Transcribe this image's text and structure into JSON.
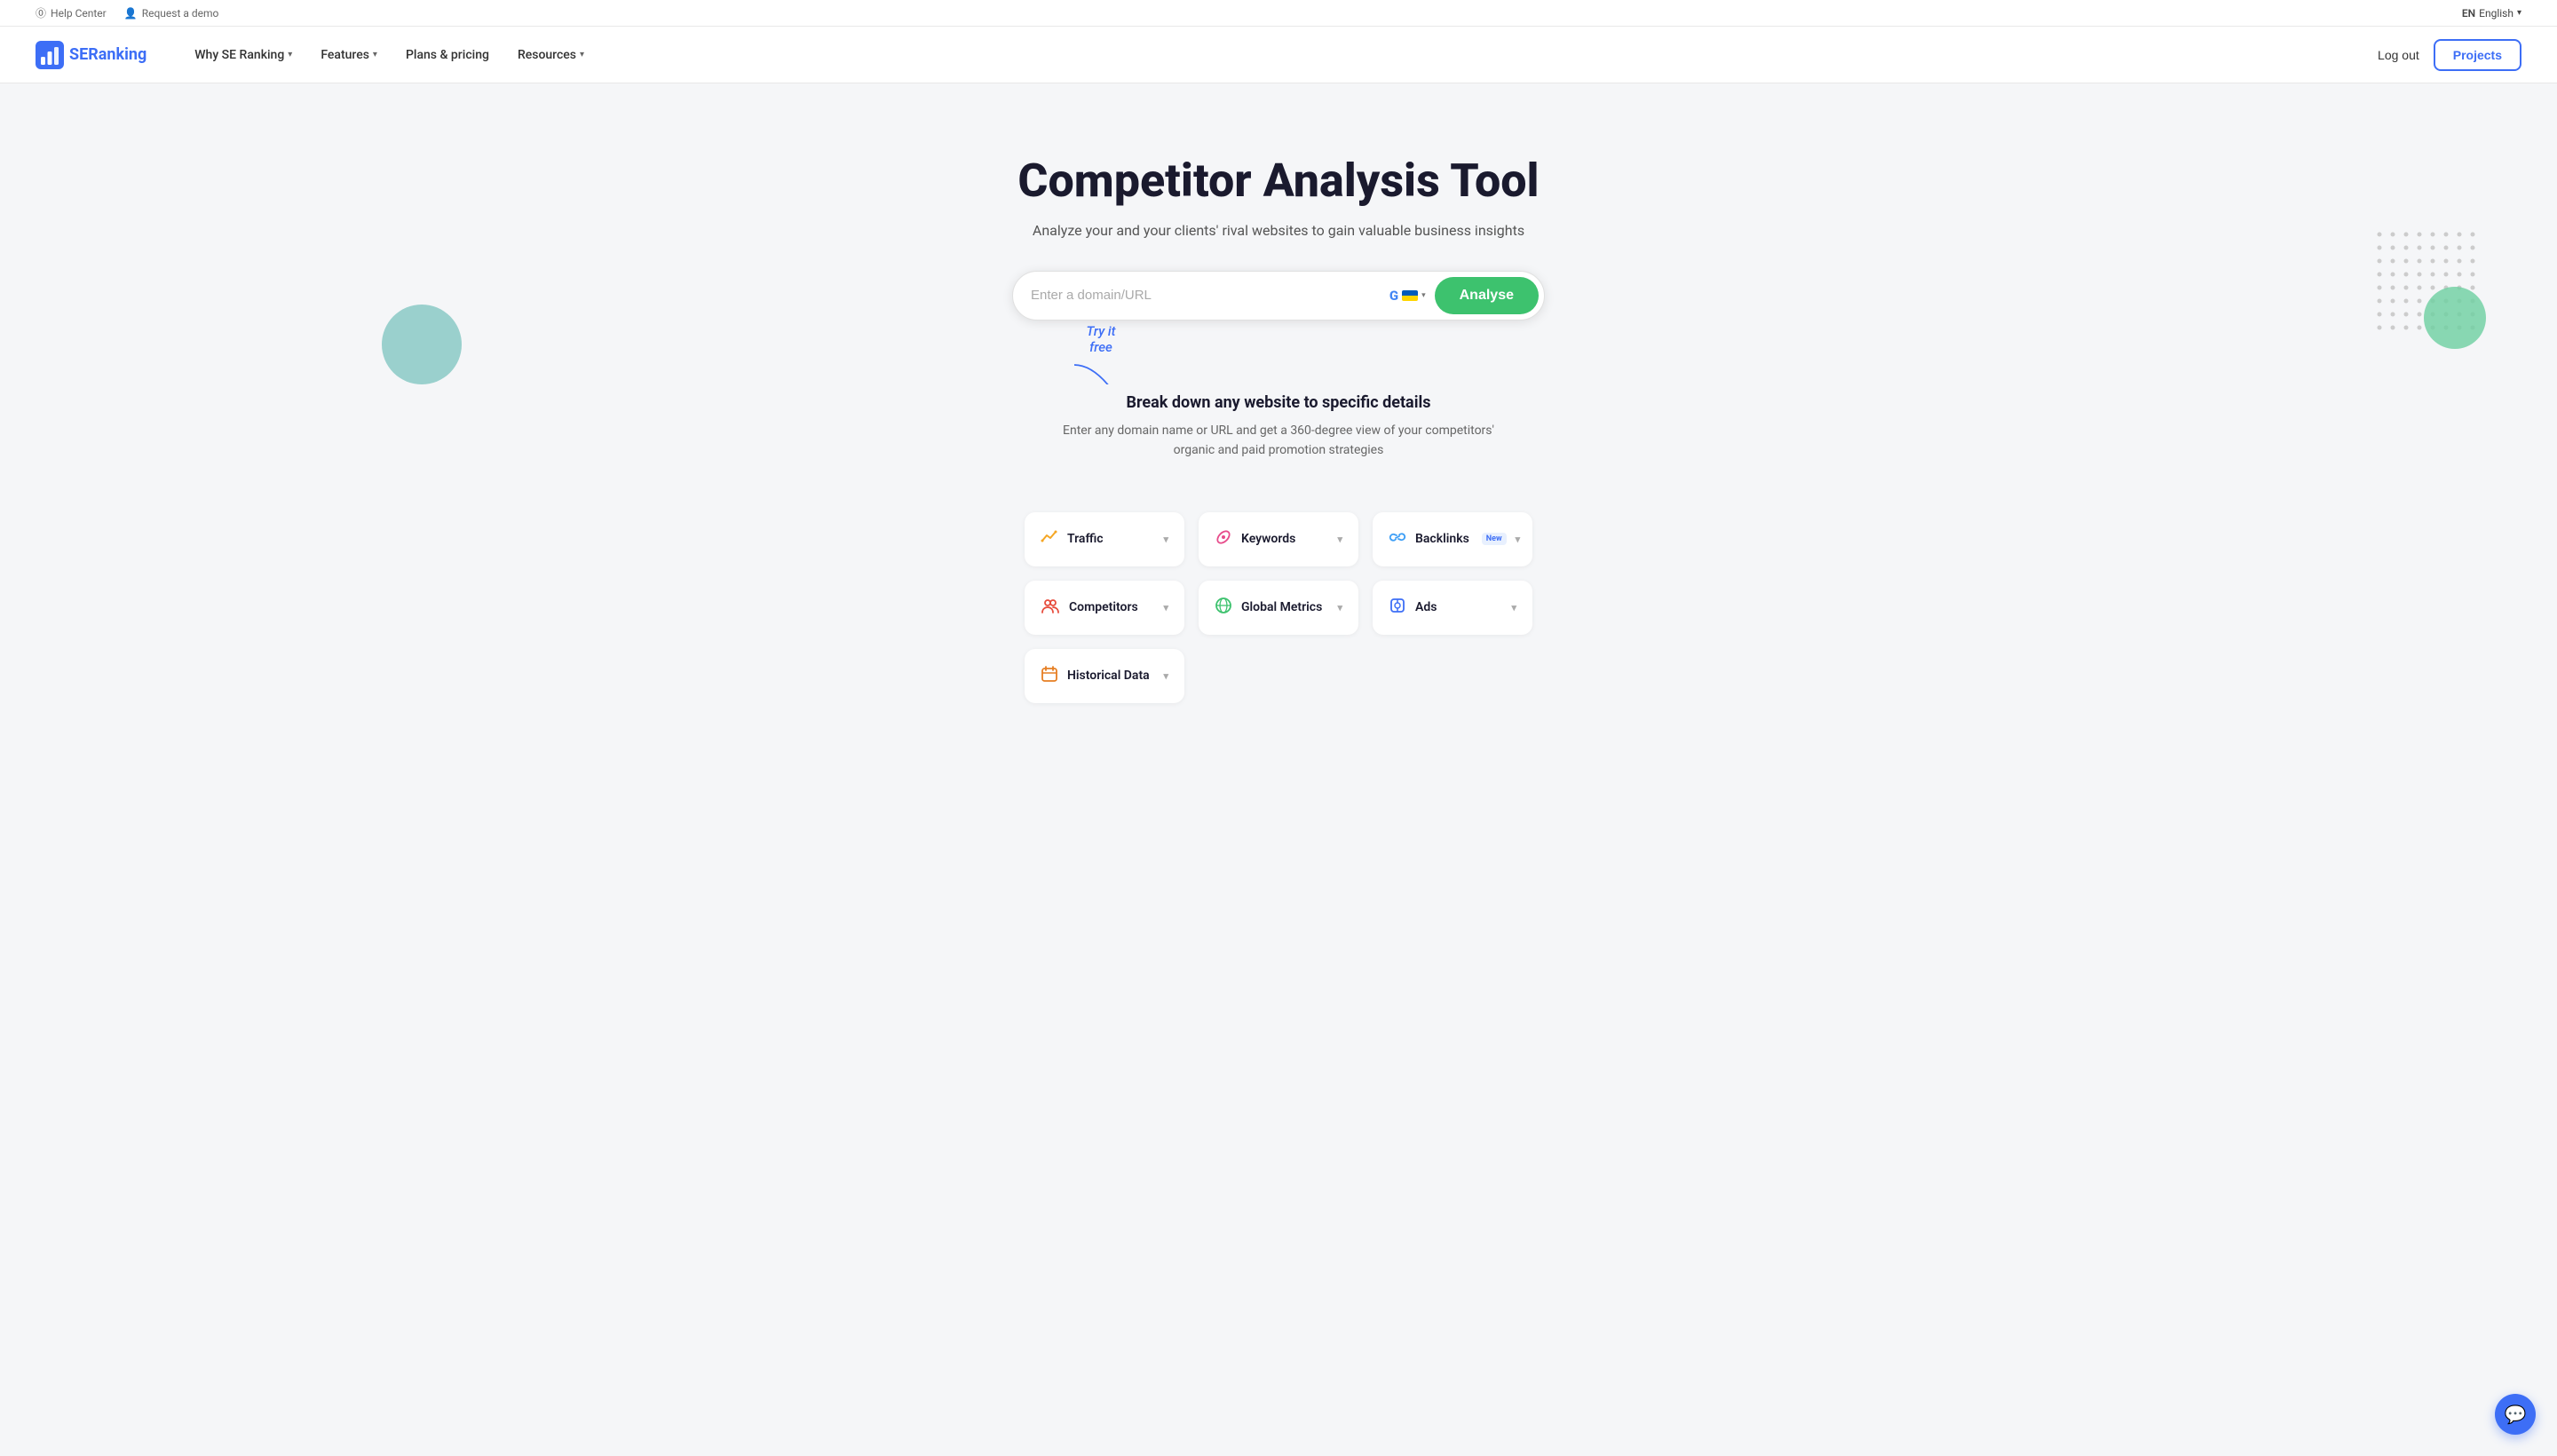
{
  "topbar": {
    "help_center": "Help Center",
    "request_demo": "Request a demo",
    "lang_code": "EN",
    "lang_name": "English"
  },
  "navbar": {
    "logo_text_se": "SE",
    "logo_text_ranking": "Ranking",
    "nav_items": [
      {
        "id": "why-se-ranking",
        "label": "Why SE Ranking",
        "has_dropdown": true
      },
      {
        "id": "features",
        "label": "Features",
        "has_dropdown": true
      },
      {
        "id": "plans-pricing",
        "label": "Plans & pricing",
        "has_dropdown": false
      },
      {
        "id": "resources",
        "label": "Resources",
        "has_dropdown": true
      }
    ],
    "logout_label": "Log out",
    "projects_label": "Projects"
  },
  "hero": {
    "title": "Competitor Analysis Tool",
    "subtitle": "Analyze your and your clients' rival websites to gain valuable business insights",
    "search_placeholder": "Enter a domain/URL",
    "analyse_button": "Analyse",
    "try_free_text": "Try it\nfree"
  },
  "breakdown": {
    "title": "Break down any website to specific details",
    "description": "Enter any domain name or URL and get a 360-degree view of your competitors' organic and paid promotion strategies"
  },
  "features": [
    {
      "id": "traffic",
      "label": "Traffic",
      "icon": "⚡",
      "has_dropdown": true,
      "badge": ""
    },
    {
      "id": "keywords",
      "label": "Keywords",
      "icon": "🔑",
      "has_dropdown": true,
      "badge": ""
    },
    {
      "id": "backlinks",
      "label": "Backlinks",
      "icon": "🔗",
      "has_dropdown": true,
      "badge": "New"
    },
    {
      "id": "competitors",
      "label": "Competitors",
      "icon": "👥",
      "has_dropdown": true,
      "badge": ""
    },
    {
      "id": "global-metrics",
      "label": "Global Metrics",
      "icon": "🌐",
      "has_dropdown": true,
      "badge": ""
    },
    {
      "id": "ads",
      "label": "Ads",
      "icon": "📋",
      "has_dropdown": true,
      "badge": ""
    },
    {
      "id": "historical-data",
      "label": "Historical Data",
      "icon": "📅",
      "has_dropdown": true,
      "badge": ""
    }
  ]
}
